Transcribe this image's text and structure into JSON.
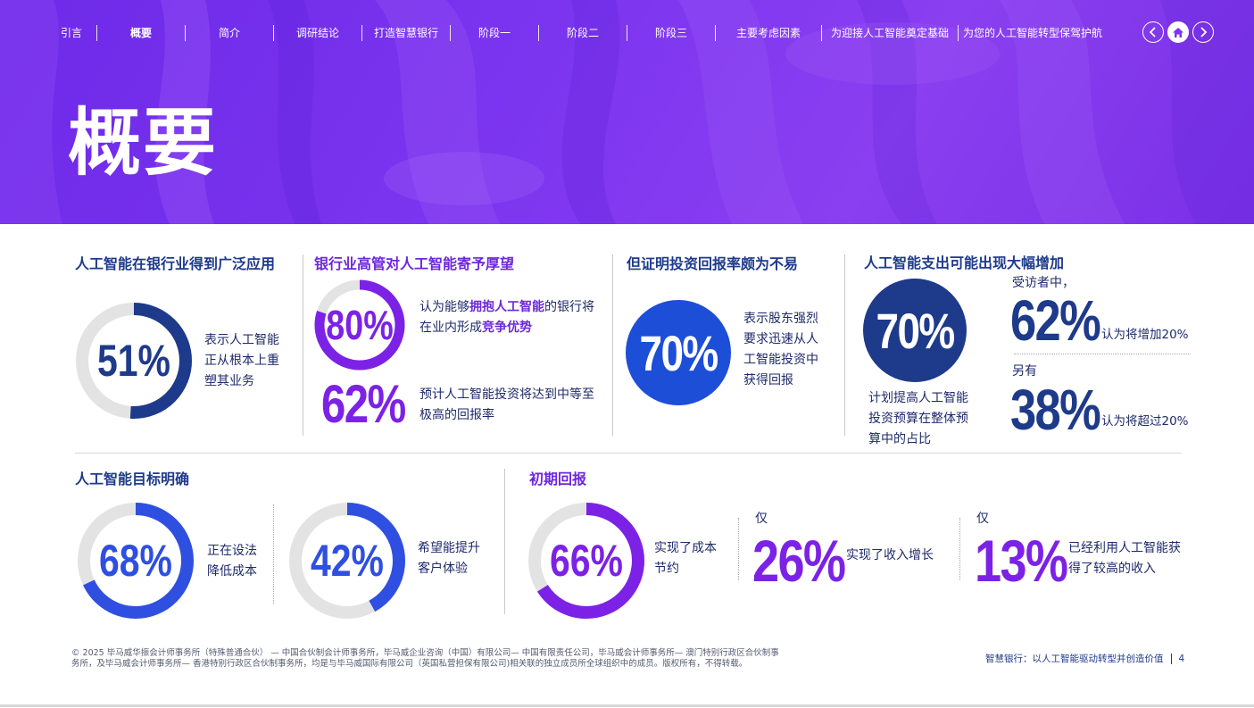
{
  "nav": {
    "items": [
      "引言",
      "概要",
      "简介",
      "调研结论",
      "打造智慧银行",
      "阶段一",
      "阶段二",
      "阶段三",
      "主要考虑因素",
      "为迎接人工智能奠定基础",
      "为您的人工智能转型保驾护航"
    ],
    "active_index": 1,
    "controls": [
      "chevron-left-icon",
      "home-icon",
      "chevron-right-icon"
    ]
  },
  "page": {
    "title": "概要"
  },
  "colors": {
    "header": "#7b34ef",
    "navy": "#1e3a8a",
    "blue": "#1d4ed8",
    "royal": "#2f4fe0",
    "purple": "#7c22e6",
    "track": "#e3e3e3"
  },
  "s1": {
    "heading": "人工智能在银行业得到广泛应用",
    "value": 51,
    "label": "51%",
    "desc": "表示人工智能正从根本上重塑其业务"
  },
  "s2": {
    "heading": "银行业高管对人工智能寄予厚望",
    "ring": {
      "value": 80,
      "label": "80%"
    },
    "desc1_a": "认为能够",
    "desc1_b": "拥抱人工智能",
    "desc1_c": "的银行将在业内形成",
    "desc1_d": "竞争优势",
    "big_label": "62%",
    "desc2": "预计人工智能投资将达到中等至极高的回报率"
  },
  "s3": {
    "heading": "但证明投资回报率颇为不易",
    "label": "70%",
    "desc": "表示股东强烈要求迅速从人工智能投资中获得回报"
  },
  "s4": {
    "heading": "人工智能支出可能出现大幅增加",
    "circle_label": "70%",
    "circle_desc": "计划提高人工智能投资预算在整体预算中的占比",
    "pre1": "受访者中，",
    "big1": "62%",
    "after1": "认为将增加20%",
    "pre2": "另有",
    "big2": "38%",
    "after2": "认为将超过20%"
  },
  "s5": {
    "heading": "人工智能目标明确",
    "ring1": {
      "value": 68,
      "label": "68%",
      "desc": "正在设法降低成本"
    },
    "ring2": {
      "value": 42,
      "label": "42%",
      "desc": "希望能提升客户体验"
    }
  },
  "s6": {
    "heading": "初期回报",
    "ring": {
      "value": 66,
      "label": "66%",
      "desc": "实现了成本节约"
    },
    "stat1": {
      "pre": "仅",
      "big": "26%",
      "desc": "实现了收入增长"
    },
    "stat2": {
      "pre": "仅",
      "big": "13%",
      "desc": "已经利用人工智能获得了较高的收入"
    }
  },
  "footer": {
    "legal": "© 2025 毕马威华振会计师事务所（特殊普通合伙） — 中国合伙制会计师事务所，毕马威企业咨询（中国）有限公司— 中国有限责任公司，毕马威会计师事务所— 澳门特别行政区合伙制事务所，及毕马威会计师事务所— 香港特别行政区合伙制事务所，均是与毕马威国际有限公司（英国私营担保有限公司)相关联的独立成员所全球组织中的成员。版权所有，不得转载。",
    "doc_title": "智慧银行：以人工智能驱动转型并创造价值",
    "page_number": "4"
  }
}
